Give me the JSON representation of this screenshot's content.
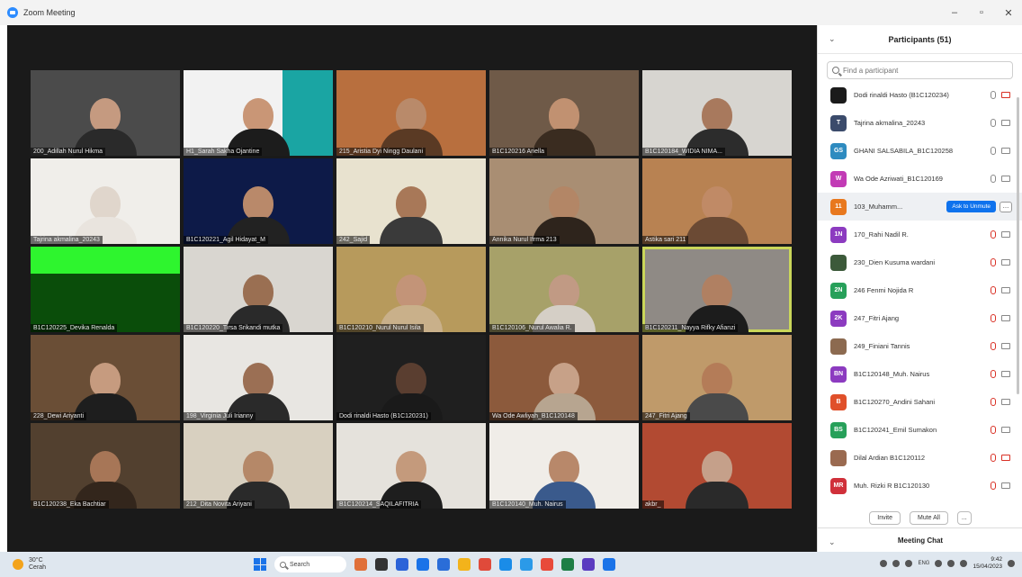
{
  "window": {
    "title": "Zoom Meeting",
    "minimize": "–",
    "maximize": "▫",
    "close": "✕"
  },
  "tiles": [
    {
      "name": "200_Adillah Nurul Hikma",
      "bg": "#4b4b4b",
      "skin": "#c59a80",
      "shirt": "#2a2a2a"
    },
    {
      "name": "H1_Sarah Sakha Ojantine",
      "bg": "#f2f2f2",
      "skin": "#c99676",
      "shirt": "#1c1c1c",
      "slide": true
    },
    {
      "name": "215_Aristia Dyi Ningg Daulani",
      "bg": "#b86f3e",
      "skin": "#b98a6a",
      "shirt": "#5a3a24"
    },
    {
      "name": "B1C120216 Ariella",
      "bg": "#6f5a48",
      "skin": "#c19171",
      "shirt": "#3a2c20"
    },
    {
      "name": "B1C120184_WIDIA NIMA...",
      "bg": "#d7d5d0",
      "skin": "#a8795d",
      "shirt": "#2c2c2c"
    },
    {
      "name": "Tajrina akmalina_20243",
      "bg": "#f0eeea",
      "skin": "#e0d6cc",
      "shirt": "#e9e4de"
    },
    {
      "name": "B1C120221_Agil Hidayat_M",
      "bg": "#0d1a48",
      "skin": "#b9896a",
      "shirt": "#222"
    },
    {
      "name": "242_Sajid",
      "bg": "#e8e2cf",
      "skin": "#a87858",
      "shirt": "#3a3a3a"
    },
    {
      "name": "Annika Nurul Ifrma 213",
      "bg": "#a98e73",
      "skin": "#b38666",
      "shirt": "#2e241c"
    },
    {
      "name": "Astika sari 211",
      "bg": "#b88252",
      "skin": "#c08a66",
      "shirt": "#6b4a34"
    },
    {
      "name": "B1C120225_Devika Renalda",
      "bg": "#0a4d0a",
      "skin": "",
      "shirt": "",
      "green": true
    },
    {
      "name": "B1C120220_Tirsa Srikandi mutka",
      "bg": "#d9d6d0",
      "skin": "#9a6f52",
      "shirt": "#2a2a2a"
    },
    {
      "name": "B1C120210_Nurul Nurul Isila",
      "bg": "#b79a5c",
      "skin": "#c39478",
      "shirt": "#c9b08a"
    },
    {
      "name": "B1C120106_Nurul Awalia R.",
      "bg": "#a7a169",
      "skin": "#c19a84",
      "shirt": "#d5cfc6"
    },
    {
      "name": "B1C120211_Nayya Rifky Afianzi",
      "bg": "#8f8a85",
      "skin": "#b08062",
      "shirt": "#1c1c1c",
      "active": true
    },
    {
      "name": "228_Dewi Ariyanti",
      "bg": "#6a4e36",
      "skin": "#c69b7f",
      "shirt": "#1e1e1e"
    },
    {
      "name": "198_Virginia Juli Irianny",
      "bg": "#e8e6e2",
      "skin": "#9b6f54",
      "shirt": "#2a2a2a"
    },
    {
      "name": "Dodi rinaldi Hasto (B1C120231)",
      "bg": "#1f1f1f",
      "skin": "#5a3e30",
      "shirt": "#1a1a1a"
    },
    {
      "name": "Wa Ode Awliyah_B1C120148",
      "bg": "#8c5a3c",
      "skin": "#c7a188",
      "shirt": "#b7a590"
    },
    {
      "name": "247_Fitri Ajang",
      "bg": "#bf9a6a",
      "skin": "#b47c58",
      "shirt": "#4a4a4a"
    },
    {
      "name": "B1C120238_Eka Bachtiar",
      "bg": "#52402f",
      "skin": "#a77657",
      "shirt": "#33261c"
    },
    {
      "name": "212_Dita Novita Ariyani",
      "bg": "#d8d0c0",
      "skin": "#b58868",
      "shirt": "#2a2a2a"
    },
    {
      "name": "B1C120214_SAQILAFITRIA",
      "bg": "#e5e2dc",
      "skin": "#c49a7c",
      "shirt": "#1e1e1e"
    },
    {
      "name": "B1C120140_Muh. Nairus",
      "bg": "#f0ede8",
      "skin": "#b8886a",
      "shirt": "#3a5a8c"
    },
    {
      "name": "akbr_",
      "bg": "#b24a32",
      "skin": "#c5a08a",
      "shirt": "#2a2a2a"
    }
  ],
  "panel": {
    "title": "Participants (51)",
    "search_placeholder": "Find a participant",
    "participants": [
      {
        "initials": "",
        "name": "Dodi rinaldi Hasto (B1C120234)",
        "color": "#1b1b1b",
        "mic_muted": false,
        "cam_muted": true
      },
      {
        "initials": "T",
        "name": "Tajrina akmalina_20243",
        "color": "#3b4b6b",
        "mic_muted": false,
        "cam_muted": false
      },
      {
        "initials": "GS",
        "name": "GHANI SALSABILA_B1C120258",
        "color": "#2e8bc0",
        "mic_muted": false,
        "cam_muted": false
      },
      {
        "initials": "W",
        "name": "Wa Ode Azriwati_B1C120169",
        "color": "#c23bb5",
        "mic_muted": false,
        "cam_muted": false
      },
      {
        "initials": "11",
        "name": "103_Muhamm...",
        "color": "#e8781e",
        "mic_muted": false,
        "cam_muted": false,
        "highlight": true
      },
      {
        "initials": "1N",
        "name": "170_Rahi Nadil R.",
        "color": "#8c3bc0",
        "mic_muted": true,
        "cam_muted": false
      },
      {
        "initials": "",
        "name": "230_Dien Kusuma wardani",
        "color": "#3c5a3a",
        "mic_muted": true,
        "cam_muted": false
      },
      {
        "initials": "2N",
        "name": "246 Fenmi Nojida R",
        "color": "#27a05a",
        "mic_muted": true,
        "cam_muted": false
      },
      {
        "initials": "2K",
        "name": "247_Fitri Ajang",
        "color": "#8c3bc0",
        "mic_muted": true,
        "cam_muted": false
      },
      {
        "initials": "",
        "name": "249_Finiani Tannis",
        "color": "#8c6a50",
        "mic_muted": true,
        "cam_muted": false
      },
      {
        "initials": "BN",
        "name": "B1C120148_Muh. Nairus",
        "color": "#8c3bc0",
        "mic_muted": true,
        "cam_muted": false
      },
      {
        "initials": "B",
        "name": "B1C120270_Andini Sahani",
        "color": "#e0502a",
        "mic_muted": true,
        "cam_muted": false
      },
      {
        "initials": "BS",
        "name": "B1C120241_Emil Sumakon",
        "color": "#27a05a",
        "mic_muted": true,
        "cam_muted": false
      },
      {
        "initials": "",
        "name": "Dilal Ardian B1C120112",
        "color": "#9a6a50",
        "mic_muted": true,
        "cam_muted": true
      },
      {
        "initials": "MR",
        "name": "Muh. Rizki R B1C120130",
        "color": "#d0303a",
        "mic_muted": true,
        "cam_muted": false
      }
    ],
    "ask_unmute": "Ask to Unmute",
    "more": "...",
    "invite": "Invite",
    "mute_all": "Mute All",
    "chat_title": "Meeting Chat"
  },
  "taskbar": {
    "weather_temp": "30°C",
    "weather_desc": "Cerah",
    "search": "Search",
    "lang": "ENG",
    "time": "9:42",
    "date": "15/04/2023"
  },
  "apps": [
    "#e0703a",
    "#333333",
    "#2b63d8",
    "#1a73e8",
    "#2a6dd8",
    "#f3b31b",
    "#e04a3a",
    "#1a8ce8",
    "#2b9ae8",
    "#e84a3a",
    "#1e7e45",
    "#5a3bc0",
    "#1a73e8"
  ]
}
